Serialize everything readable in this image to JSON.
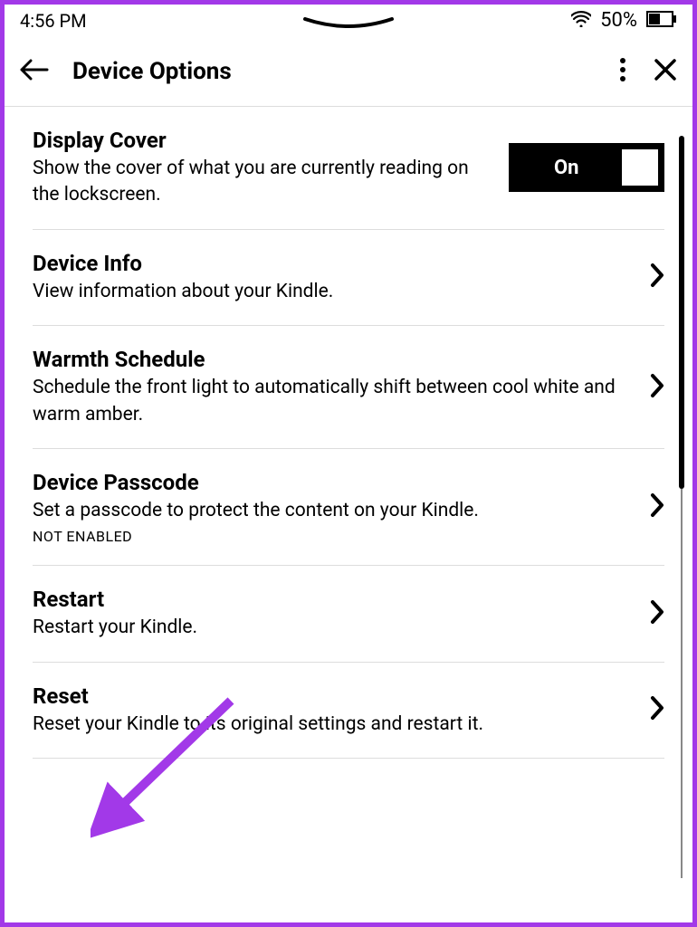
{
  "status": {
    "time": "4:56 PM",
    "battery_pct": "50%"
  },
  "header": {
    "title": "Device Options"
  },
  "toggle": {
    "on_label": "On"
  },
  "items": [
    {
      "title": "Display Cover",
      "desc": "Show the cover of what you are currently reading on the lockscreen.",
      "type": "toggle"
    },
    {
      "title": "Device Info",
      "desc": "View information about your Kindle.",
      "type": "nav"
    },
    {
      "title": "Warmth Schedule",
      "desc": "Schedule the front light to automatically shift between cool white and warm amber.",
      "type": "nav"
    },
    {
      "title": "Device Passcode",
      "desc": "Set a passcode to protect the content on your Kindle.",
      "status": "NOT ENABLED",
      "type": "nav"
    },
    {
      "title": "Restart",
      "desc": "Restart your Kindle.",
      "type": "nav"
    },
    {
      "title": "Reset",
      "desc": "Reset your Kindle to its original settings and restart it.",
      "type": "nav"
    }
  ]
}
